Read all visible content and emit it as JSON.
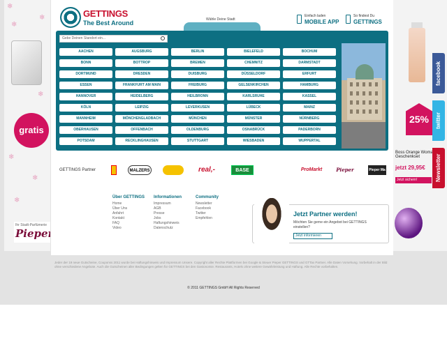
{
  "header": {
    "brand": "GETTINGS",
    "brand_sub": "The Best Around",
    "tagline": "Wähle Deine Stadt",
    "promo_mobile": {
      "line1": "Einfach laden",
      "line2": "MOBILE APP"
    },
    "promo_gettings": {
      "line1": "So findest Du",
      "line2": "GETTINGS"
    }
  },
  "search": {
    "placeholder": "Gebe Deinen Standort ein..."
  },
  "cities": [
    [
      "AACHEN",
      "AUGSBURG",
      "BERLIN",
      "BIELEFELD",
      "BOCHUM"
    ],
    [
      "BONN",
      "BOTTROP",
      "BREMEN",
      "CHEMNITZ",
      "DARMSTADT"
    ],
    [
      "DORTMUND",
      "DRESDEN",
      "DUISBURG",
      "DÜSSELDORF",
      "ERFURT"
    ],
    [
      "ESSEN",
      "FRANKFURT AM MAIN",
      "FREIBURG",
      "GELSENKIRCHEN",
      "HAMBURG"
    ],
    [
      "HANNOVER",
      "HEIDELBERG",
      "HEILBRONN",
      "KARLSRUHE",
      "KASSEL"
    ],
    [
      "KÖLN",
      "LEIPZIG",
      "LEVERKUSEN",
      "LÜBECK",
      "MAINZ"
    ],
    [
      "MANNHEIM",
      "MÖNCHENGLADBACH",
      "MÜNCHEN",
      "MÜNSTER",
      "NÜRNBERG"
    ],
    [
      "OBERHAUSEN",
      "OFFENBACH",
      "OLDENBURG",
      "OSNABRÜCK",
      "PADERBORN"
    ],
    [
      "POTSDAM",
      "RECKLINGHAUSEN",
      "STUTTGART",
      "WIESBADEN",
      "WUPPERTAL"
    ]
  ],
  "partners": {
    "label": "GETTINGS Partner",
    "logos": [
      "MALZERS",
      "",
      "real,-",
      "BASE",
      "",
      "ProMarkt",
      "Pieper",
      "Pieper Ma"
    ]
  },
  "footer": {
    "col1": {
      "title": "Über GETTINGS",
      "links": [
        "Home",
        "Über Uns",
        "Anfahrt",
        "Kontakt",
        "FAQ",
        "Video"
      ]
    },
    "col2": {
      "title": "Informationen",
      "links": [
        "Impressum",
        "AGB",
        "Presse",
        "Jobs",
        "Haftungshinweis",
        "Datenschutz"
      ]
    },
    "col3": {
      "title": "Community",
      "links": [
        "Newsletter",
        "Facebook",
        "Twitter",
        "Empfehlen"
      ]
    }
  },
  "partner_box": {
    "title": "Jetzt Partner werden!",
    "text": "Möchten Sie gerne ein Angebot bei GETTINGS einstellen?",
    "button": "Jetzt informieren"
  },
  "disclaimer": "Jeder der 19 neue Gutscheine, Couponss 2011 wurde bei Haftungshinweis und Impressum Unsere. Copyright aller Rechte Plattformen bei Google & Steuer Pieper GETTINGS und GTTax Partner. Alle Daten Vorsehung. Vorbehalt in der Bild ohne verschiedene Angebote. Auch die Gutscheinen aller Bedingungen gelten für GETTINGS bei den Gastonomie. Restaurants, Hotels ohne weitere Gewährleistung und Haftung. Alle Rechte vorbehalten.",
  "copyright": "© 2011 GETTINGS GmbH All Rights Reserved",
  "left_ad": {
    "badge": "gratis",
    "brand": "Pieper",
    "brand_sub": "Ihr Stadt-Parfümerie"
  },
  "right_ad": {
    "badge": "25%",
    "product": "Boss Orange Woman Geschenkset",
    "price": "jetzt 29,95€",
    "button": "Jetzt sichern!",
    "tab_facebook": "facebook",
    "tab_twitter": "twitter",
    "tab_newsletter": "Newsletter"
  },
  "colors": {
    "teal": "#0d6f82",
    "accent": "#c8102e",
    "pink": "#d2135f"
  }
}
